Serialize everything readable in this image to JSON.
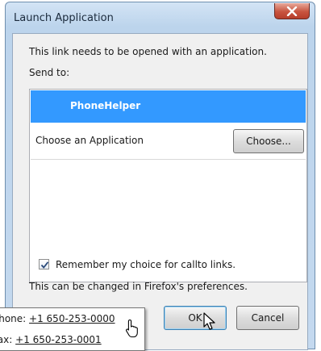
{
  "window": {
    "title": "Launch Application",
    "close_icon": "close-x-icon"
  },
  "dialog": {
    "message": "This link needs to be opened with an application.",
    "send_to_label": "Send to:",
    "apps": [
      {
        "label": "PhoneHelper",
        "selected": true
      },
      {
        "label": "Choose an Application",
        "selected": false
      }
    ],
    "choose_button": "Choose...",
    "remember_checkbox": {
      "checked": true,
      "label": "Remember my choice for callto links."
    },
    "note": "This can be changed in Firefox's preferences.",
    "ok_button": "OK",
    "cancel_button": "Cancel"
  },
  "tooltip": {
    "phone_label": "Phone:",
    "phone_number": "+1 650-253-0000",
    "fax_label": "Fax:",
    "fax_number": "+1 650-253-0001"
  },
  "colors": {
    "selection": "#3399ff",
    "close_button": "#c8543f",
    "window_frame": "#bcd4ec"
  }
}
